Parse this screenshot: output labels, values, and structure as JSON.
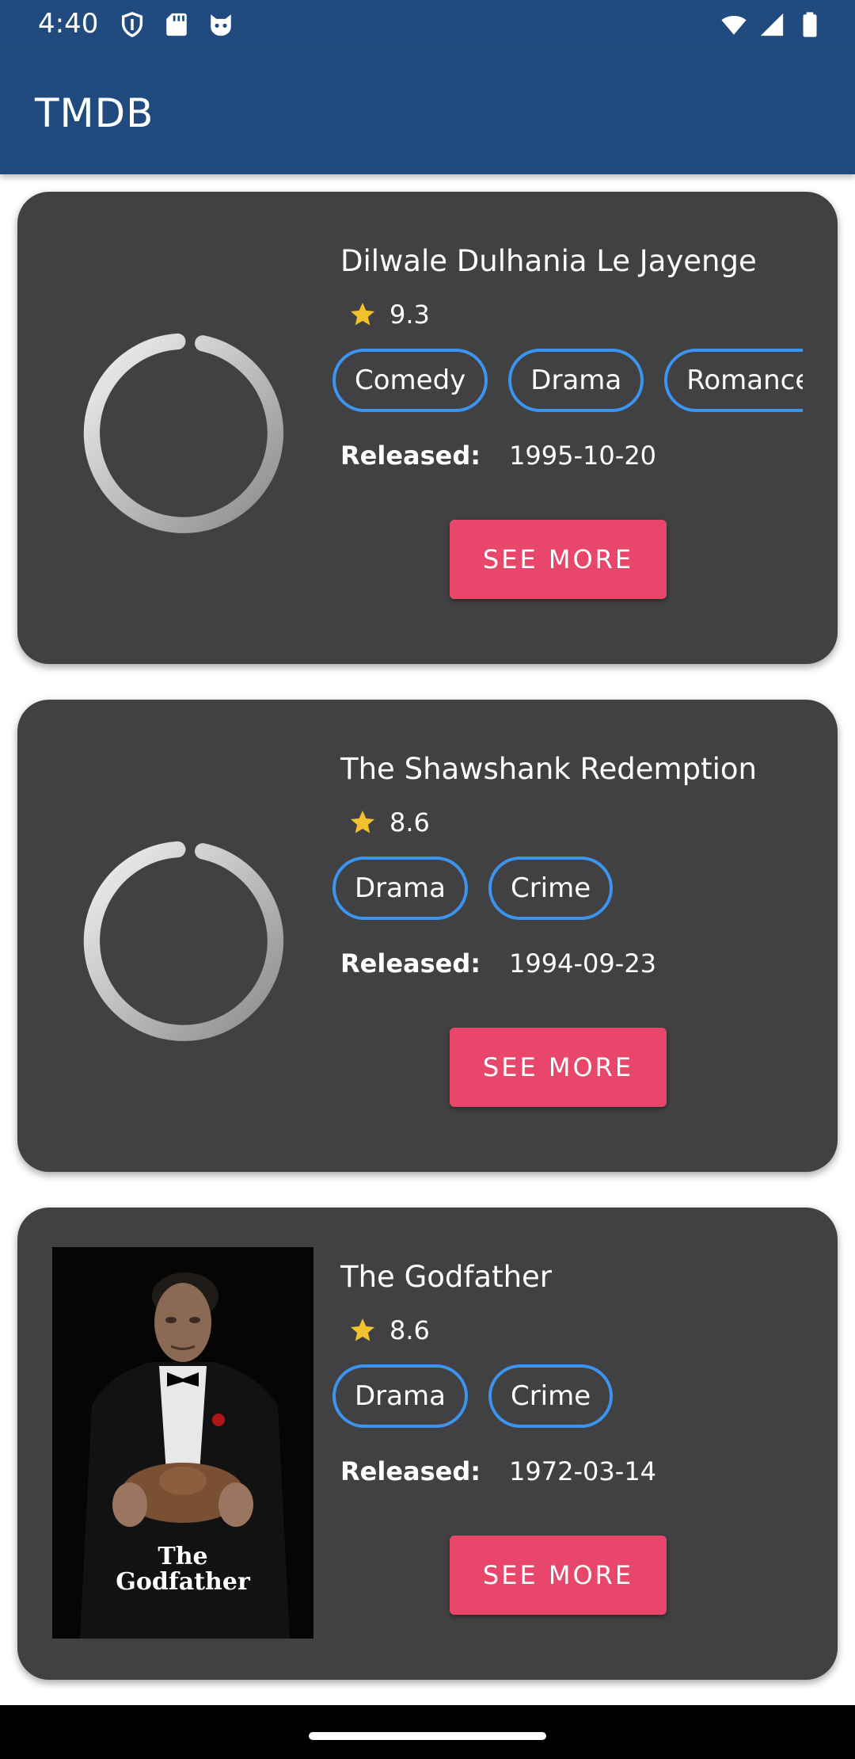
{
  "status_bar": {
    "time": "4:40",
    "left_icons": [
      "shield-icon",
      "sd-card-icon",
      "cat-face-icon"
    ],
    "right_icons": [
      "wifi-icon",
      "signal-icon",
      "battery-icon"
    ]
  },
  "app_bar": {
    "title": "TMDB",
    "color": "#214b7e"
  },
  "movies": [
    {
      "title": "Dilwale Dulhania Le Jayenge",
      "rating": "9.3",
      "genres": [
        "Comedy",
        "Drama",
        "Romance"
      ],
      "released_label": "Released:",
      "released": "1995-10-20",
      "poster": "loading-spinner",
      "button": "SEE MORE"
    },
    {
      "title": "The Shawshank Redemption",
      "rating": "8.6",
      "genres": [
        "Drama",
        "Crime"
      ],
      "released_label": "Released:",
      "released": "1994-09-23",
      "poster": "loading-spinner",
      "button": "SEE MORE"
    },
    {
      "title": "The Godfather",
      "rating": "8.6",
      "genres": [
        "Drama",
        "Crime"
      ],
      "released_label": "Released:",
      "released": "1972-03-14",
      "poster": "godfather-poster",
      "poster_text": "The Godfather",
      "button": "SEE MORE"
    }
  ],
  "colors": {
    "card": "#414042",
    "chip_border": "#3b95ef",
    "button": "#e8466a",
    "star": "#f2c12e"
  }
}
